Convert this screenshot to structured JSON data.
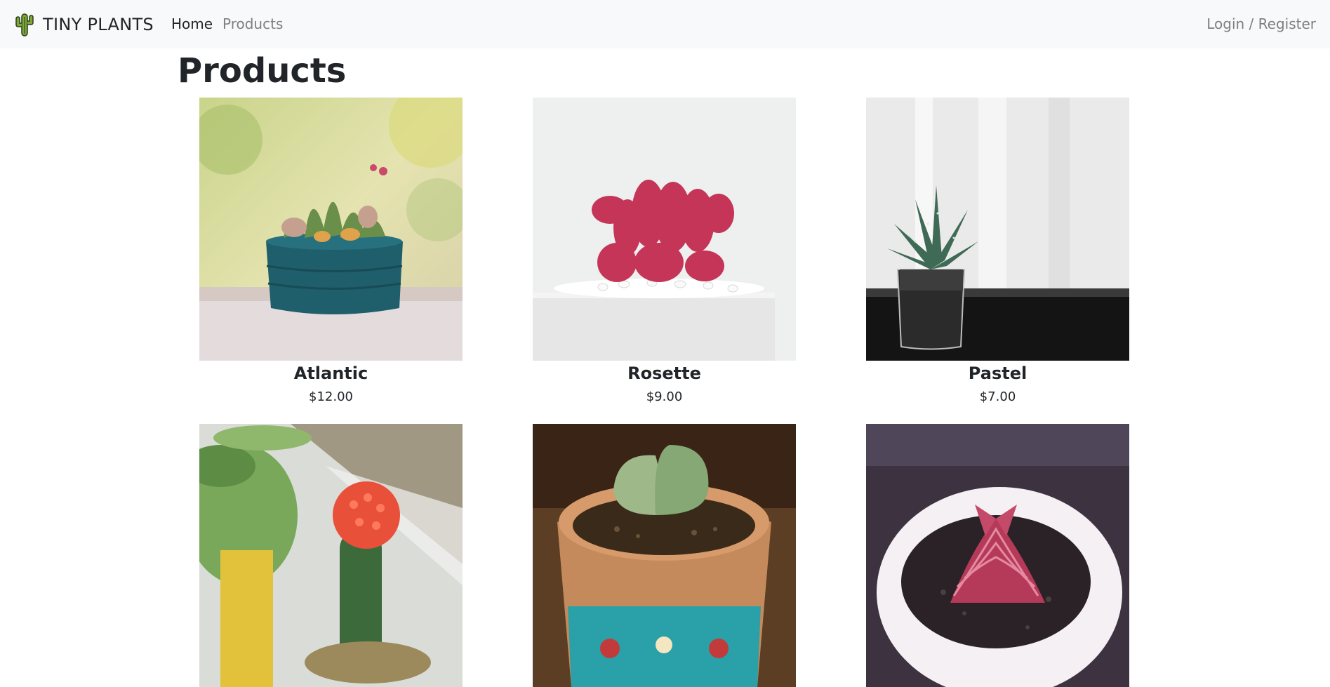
{
  "navbar": {
    "brand": "TINY PLANTS",
    "brand_icon": "cactus-icon",
    "links": [
      {
        "label": "Home"
      },
      {
        "label": "Products"
      }
    ],
    "auth_label": "Login / Register"
  },
  "page": {
    "title": "Products"
  },
  "products": [
    {
      "name": "Atlantic",
      "price": "$12.00"
    },
    {
      "name": "Rosette",
      "price": "$9.00"
    },
    {
      "name": "Pastel",
      "price": "$7.00"
    },
    {
      "name": "",
      "price": ""
    },
    {
      "name": "",
      "price": ""
    },
    {
      "name": "",
      "price": ""
    }
  ],
  "colors": {
    "navbar_bg": "#f8f9fa",
    "text_dark": "#212529",
    "text_muted": "#7f7f7f",
    "brand_icon_green": "#6a9a2a"
  }
}
